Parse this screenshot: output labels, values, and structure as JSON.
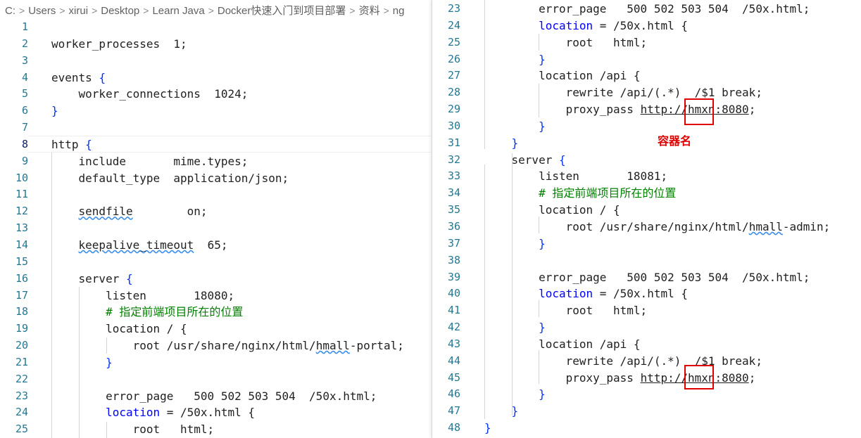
{
  "breadcrumb": [
    "C:",
    "Users",
    "xirui",
    "Desktop",
    "Learn Java",
    "Docker快速入门到项目部署",
    "资料",
    "ng"
  ],
  "left_lines": [
    {
      "n": "1",
      "t": ""
    },
    {
      "n": "2",
      "t": "worker_processes  1;"
    },
    {
      "n": "3",
      "t": ""
    },
    {
      "n": "4",
      "t": "events {"
    },
    {
      "n": "5",
      "t": "    worker_connections  1024;"
    },
    {
      "n": "6",
      "t": "}"
    },
    {
      "n": "7",
      "t": ""
    },
    {
      "n": "8",
      "t": "http {"
    },
    {
      "n": "9",
      "t": "    include       mime.types;"
    },
    {
      "n": "10",
      "t": "    default_type  application/json;"
    },
    {
      "n": "11",
      "t": ""
    },
    {
      "n": "12",
      "t": "    sendfile        on;"
    },
    {
      "n": "13",
      "t": ""
    },
    {
      "n": "14",
      "t": "    keepalive_timeout  65;"
    },
    {
      "n": "15",
      "t": ""
    },
    {
      "n": "16",
      "t": "    server {"
    },
    {
      "n": "17",
      "t": "        listen       18080;"
    },
    {
      "n": "18",
      "t": "        # 指定前端项目所在的位置"
    },
    {
      "n": "19",
      "t": "        location / {"
    },
    {
      "n": "20",
      "t": "            root /usr/share/nginx/html/hmall-portal;"
    },
    {
      "n": "21",
      "t": "        }"
    },
    {
      "n": "22",
      "t": ""
    },
    {
      "n": "23",
      "t": "        error_page   500 502 503 504  /50x.html;"
    },
    {
      "n": "24",
      "t": "        location = /50x.html {"
    },
    {
      "n": "25",
      "t": "            root   html;"
    }
  ],
  "right_lines": [
    {
      "n": "23",
      "t": "        error_page   500 502 503 504  /50x.html;"
    },
    {
      "n": "24",
      "t": "        location = /50x.html {"
    },
    {
      "n": "25",
      "t": "            root   html;"
    },
    {
      "n": "26",
      "t": "        }"
    },
    {
      "n": "27",
      "t": "        location /api {"
    },
    {
      "n": "28",
      "t": "            rewrite /api/(.*)  /$1 break;"
    },
    {
      "n": "29",
      "t": "            proxy_pass http://hmxn:8080;"
    },
    {
      "n": "30",
      "t": "        }"
    },
    {
      "n": "31",
      "t": "    }"
    },
    {
      "n": "32",
      "t": "    server {"
    },
    {
      "n": "33",
      "t": "        listen       18081;"
    },
    {
      "n": "34",
      "t": "        # 指定前端项目所在的位置"
    },
    {
      "n": "35",
      "t": "        location / {"
    },
    {
      "n": "36",
      "t": "            root /usr/share/nginx/html/hmall-admin;"
    },
    {
      "n": "37",
      "t": "        }"
    },
    {
      "n": "38",
      "t": ""
    },
    {
      "n": "39",
      "t": "        error_page   500 502 503 504  /50x.html;"
    },
    {
      "n": "40",
      "t": "        location = /50x.html {"
    },
    {
      "n": "41",
      "t": "            root   html;"
    },
    {
      "n": "42",
      "t": "        }"
    },
    {
      "n": "43",
      "t": "        location /api {"
    },
    {
      "n": "44",
      "t": "            rewrite /api/(.*)  /$1 break;"
    },
    {
      "n": "45",
      "t": "            proxy_pass http://hmxn:8080;"
    },
    {
      "n": "46",
      "t": "        }"
    },
    {
      "n": "47",
      "t": "    }"
    },
    {
      "n": "48",
      "t": "}"
    }
  ],
  "annotation": "容器名",
  "colors": {
    "line_number": "#237893",
    "keyword": "#0000ff",
    "comment": "#008000",
    "highlight": "#e00000"
  }
}
